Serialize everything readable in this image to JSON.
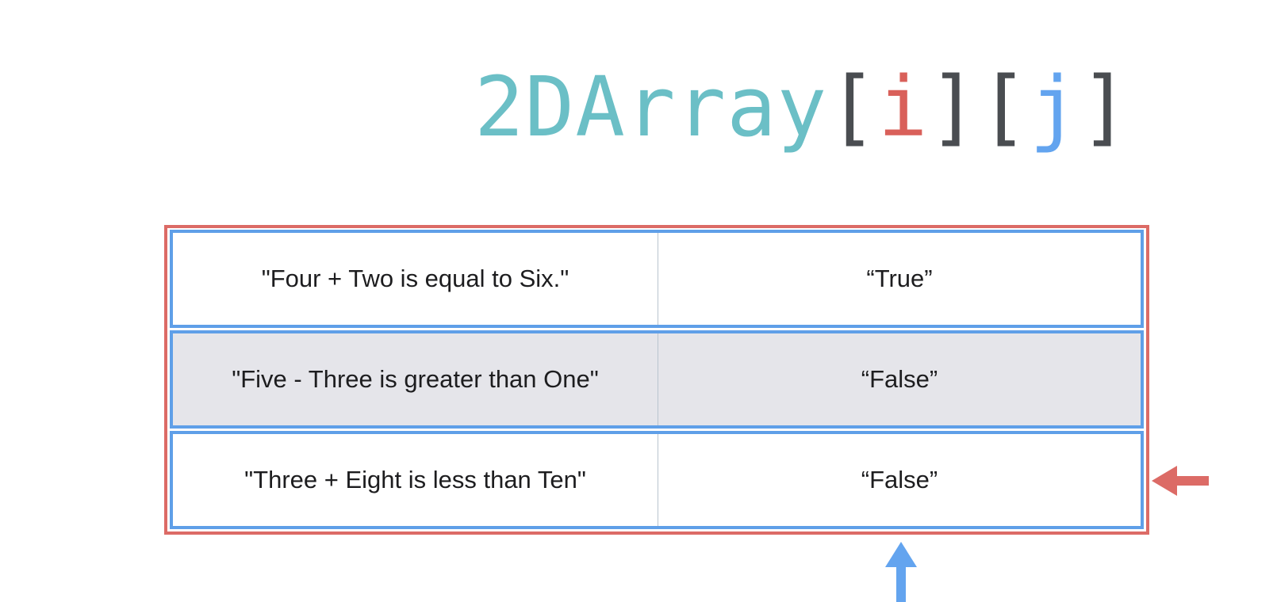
{
  "title": {
    "name": "2DArray",
    "open_bracket_1": "[",
    "index_i": "i",
    "close_bracket_1": "]",
    "open_bracket_2": "[",
    "index_j": "j",
    "close_bracket_2": "]"
  },
  "array": {
    "rows": [
      [
        "\"Four + Two is equal to Six.\"",
        "“True”"
      ],
      [
        "\"Five - Three is greater than One\"",
        "“False”"
      ],
      [
        "\"Three + Eight is less than Ten\"",
        "“False”"
      ]
    ],
    "highlighted_row": 1
  },
  "colors": {
    "title": "#6bbfc6",
    "bracket": "#4a4d51",
    "index_i": "#d9605a",
    "index_j": "#63a4ef",
    "outer_border": "#dc6b66",
    "row_border": "#5f9fe8",
    "highlight_fill": "#e5e5ea"
  },
  "icons": {
    "row_pointer": "red-arrow-left-icon",
    "column_pointer": "blue-arrow-up-icon"
  }
}
